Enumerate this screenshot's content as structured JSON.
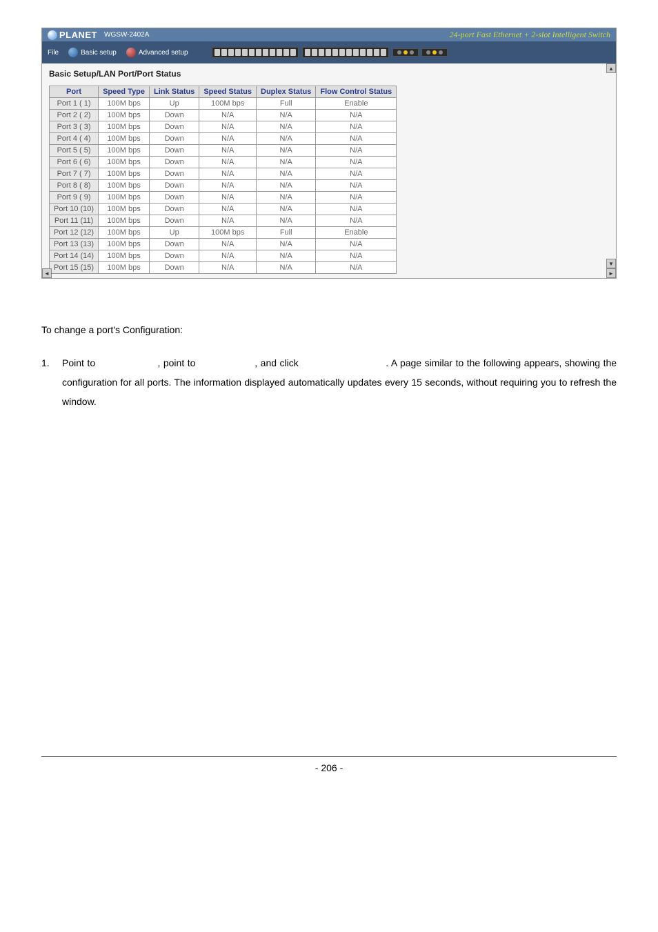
{
  "header": {
    "brand": "PLANET",
    "model": "WGSW-2402A",
    "tagline": "24-port Fast Ethernet + 2-slot Intelligent Switch"
  },
  "nav": {
    "file": "File",
    "basic": "Basic setup",
    "advanced": "Advanced setup"
  },
  "section_title": "Basic Setup/LAN Port/Port Status",
  "table": {
    "headers": [
      "Port",
      "Speed Type",
      "Link Status",
      "Speed Status",
      "Duplex Status",
      "Flow Control Status"
    ],
    "rows": [
      [
        "Port 1 ( 1)",
        "100M bps",
        "Up",
        "100M bps",
        "Full",
        "Enable"
      ],
      [
        "Port 2 ( 2)",
        "100M bps",
        "Down",
        "N/A",
        "N/A",
        "N/A"
      ],
      [
        "Port 3 ( 3)",
        "100M bps",
        "Down",
        "N/A",
        "N/A",
        "N/A"
      ],
      [
        "Port 4 ( 4)",
        "100M bps",
        "Down",
        "N/A",
        "N/A",
        "N/A"
      ],
      [
        "Port 5 ( 5)",
        "100M bps",
        "Down",
        "N/A",
        "N/A",
        "N/A"
      ],
      [
        "Port 6 ( 6)",
        "100M bps",
        "Down",
        "N/A",
        "N/A",
        "N/A"
      ],
      [
        "Port 7 ( 7)",
        "100M bps",
        "Down",
        "N/A",
        "N/A",
        "N/A"
      ],
      [
        "Port 8 ( 8)",
        "100M bps",
        "Down",
        "N/A",
        "N/A",
        "N/A"
      ],
      [
        "Port 9 ( 9)",
        "100M bps",
        "Down",
        "N/A",
        "N/A",
        "N/A"
      ],
      [
        "Port 10 (10)",
        "100M bps",
        "Down",
        "N/A",
        "N/A",
        "N/A"
      ],
      [
        "Port 11 (11)",
        "100M bps",
        "Down",
        "N/A",
        "N/A",
        "N/A"
      ],
      [
        "Port 12 (12)",
        "100M bps",
        "Up",
        "100M bps",
        "Full",
        "Enable"
      ],
      [
        "Port 13 (13)",
        "100M bps",
        "Down",
        "N/A",
        "N/A",
        "N/A"
      ],
      [
        "Port 14 (14)",
        "100M bps",
        "Down",
        "N/A",
        "N/A",
        "N/A"
      ],
      [
        "Port 15 (15)",
        "100M bps",
        "Down",
        "N/A",
        "N/A",
        "N/A"
      ]
    ]
  },
  "instructions": {
    "title": "To change a port's Configuration:",
    "step_num": "1.",
    "step_text_1": "Point to ",
    "step_text_2": ", point to ",
    "step_text_3": ", and click ",
    "step_text_4": ". A page similar to the following appears, showing the configuration for all ports. The information displayed automatically updates every 15 seconds, without requiring you to refresh the window."
  },
  "page_number": "- 206 -"
}
